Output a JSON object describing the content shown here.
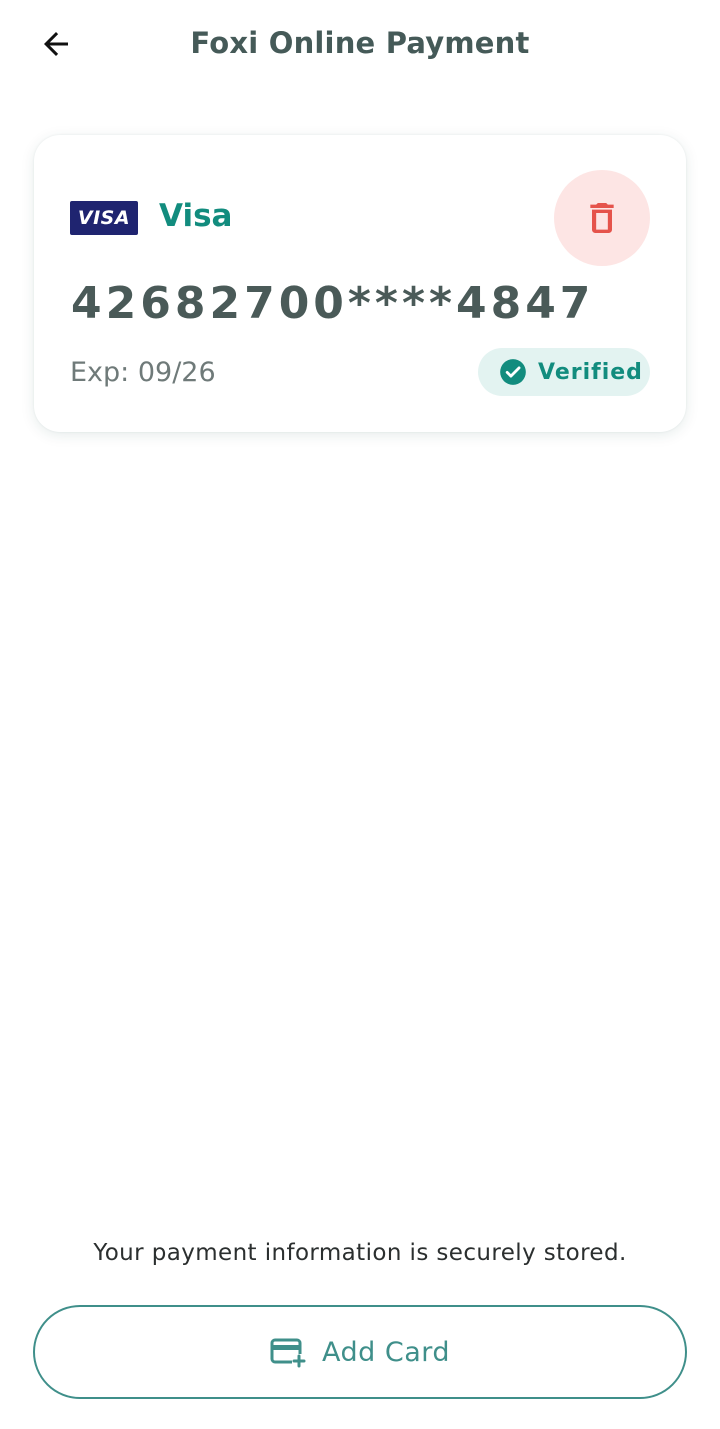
{
  "header": {
    "title": "Foxi Online Payment",
    "back_icon": "arrow-left-icon"
  },
  "card": {
    "brand_logo_text": "VISA",
    "brand_name": "Visa",
    "number": "42682700****4847",
    "expiry": "Exp: 09/26",
    "status": "Verified",
    "delete_icon": "trash-icon",
    "status_icon": "check-circle-icon"
  },
  "footer": {
    "secure_note": "Your payment information is securely stored.",
    "add_card_label": "Add Card",
    "add_card_icon": "credit-card-plus-icon"
  },
  "colors": {
    "accent": "#128c7e",
    "title": "#455a58",
    "danger": "#e5534b",
    "danger_bg": "#fde5e4",
    "badge_bg": "#e3f3f1",
    "visa_blue": "#1f2470",
    "button_outline": "#3f8f8a"
  }
}
